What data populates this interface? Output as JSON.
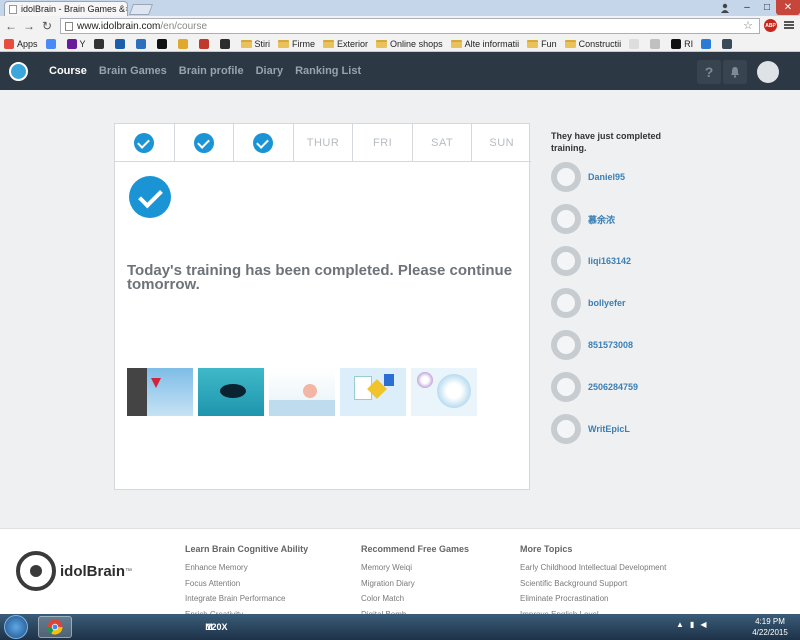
{
  "browser": {
    "tab_title": "idolBrain - Brain Games &",
    "tab_close": "×",
    "url_host": "www.idolbrain.com",
    "url_path": "/en/course",
    "window_buttons": {
      "minimize": "–",
      "maximize": "□",
      "close": "✕"
    },
    "abp_label": "ABP",
    "bookmarks": [
      {
        "label": "Apps",
        "color": "#e84c3d"
      },
      {
        "label": "",
        "color": "#4a8af4"
      },
      {
        "label": "Y",
        "color": "#6a1b9a"
      },
      {
        "label": "",
        "color": "#333333"
      },
      {
        "label": "",
        "color": "#1d5ea8"
      },
      {
        "label": "",
        "color": "#2b6fbd"
      },
      {
        "label": "",
        "color": "#111111"
      },
      {
        "label": "",
        "color": "#e0a82e"
      },
      {
        "label": "",
        "color": "#c0392b"
      },
      {
        "label": "",
        "color": "#2d2d2d"
      },
      {
        "label": "Stiri",
        "folder": true
      },
      {
        "label": "Firme",
        "folder": true
      },
      {
        "label": "Exterior",
        "folder": true
      },
      {
        "label": "Online shops",
        "folder": true
      },
      {
        "label": "Alte informatii",
        "folder": true
      },
      {
        "label": "Fun",
        "folder": true
      },
      {
        "label": "Constructii",
        "folder": true
      },
      {
        "label": "",
        "color": "#dddddd"
      },
      {
        "label": "",
        "color": "#c0c0c0"
      },
      {
        "label": "RI",
        "color": "#111111"
      },
      {
        "label": "",
        "color": "#2b7cd3"
      },
      {
        "label": "",
        "color": "#3a4a5a"
      }
    ]
  },
  "site": {
    "nav": [
      "Course",
      "Brain Games",
      "Brain profile",
      "Diary",
      "Ranking List"
    ],
    "help_icon": "?",
    "week": [
      {
        "day": "",
        "done": true
      },
      {
        "day": "",
        "done": true
      },
      {
        "day": "",
        "done": true
      },
      {
        "day": "THUR",
        "done": false
      },
      {
        "day": "FRI",
        "done": false
      },
      {
        "day": "SAT",
        "done": false
      },
      {
        "day": "SUN",
        "done": false
      }
    ],
    "completed_message": "Today's training has been completed. Please continue tomorrow.",
    "side_title": "They have just completed training.",
    "users": [
      "Daniel95",
      "慕余浓",
      "liqi163142",
      "bollyefer",
      "851573008",
      "2506284759",
      "WritEpicL"
    ]
  },
  "footer": {
    "logo_text": "idolBrain",
    "logo_tm": "™",
    "col1": {
      "title": "Learn Brain Cognitive Ability",
      "links": [
        "Enhance Memory",
        "Focus Attention",
        "Integrate Brain Performance",
        "Enrich Creativity"
      ]
    },
    "col2": {
      "title": "Recommend Free Games",
      "links": [
        "Memory Weiqi",
        "Migration Diary",
        "Color Match",
        "Digital Bomb"
      ]
    },
    "col3": {
      "title": "More Topics",
      "links": [
        "Early Childhood Intellectual Development",
        "Scientific Background Support",
        "Eliminate Procrastination",
        "Improve English Level"
      ]
    }
  },
  "taskbar": {
    "apps": [
      "",
      "",
      "",
      "",
      "M",
      "120X",
      ""
    ],
    "time": "4:19 PM",
    "date": "4/22/2015"
  }
}
